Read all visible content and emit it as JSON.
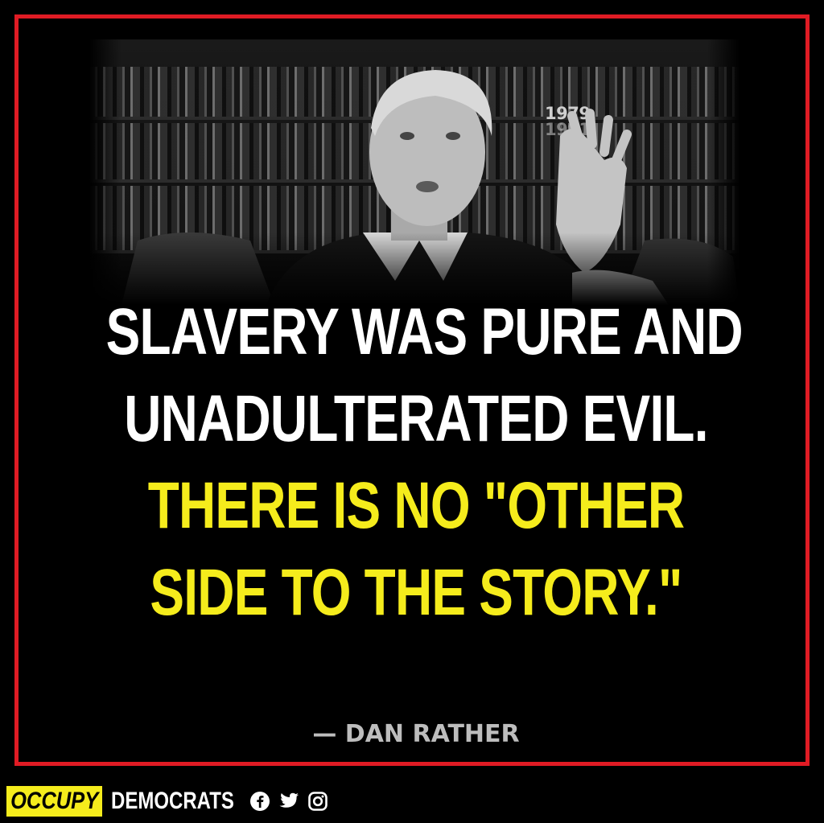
{
  "photo": {
    "description_hidden": "",
    "shelf_label_1": "1979",
    "shelf_label_2": "1991"
  },
  "quote": {
    "line1": "SLAVERY WAS PURE AND",
    "line2": "UNADULTERATED EVIL.",
    "line3": "THERE IS NO \"OTHER",
    "line4": "SIDE TO THE STORY.\""
  },
  "attribution": "— DAN RATHER",
  "brand": {
    "occupy": "OCCUPY",
    "democrats": "DEMOCRATS"
  },
  "social_icons": [
    "facebook-icon",
    "twitter-icon",
    "instagram-icon"
  ],
  "colors": {
    "frame_border": "#e01b24",
    "quote_white": "#ffffff",
    "quote_yellow": "#f5ec1c",
    "attribution": "#bdbdbd",
    "background": "#000000"
  }
}
